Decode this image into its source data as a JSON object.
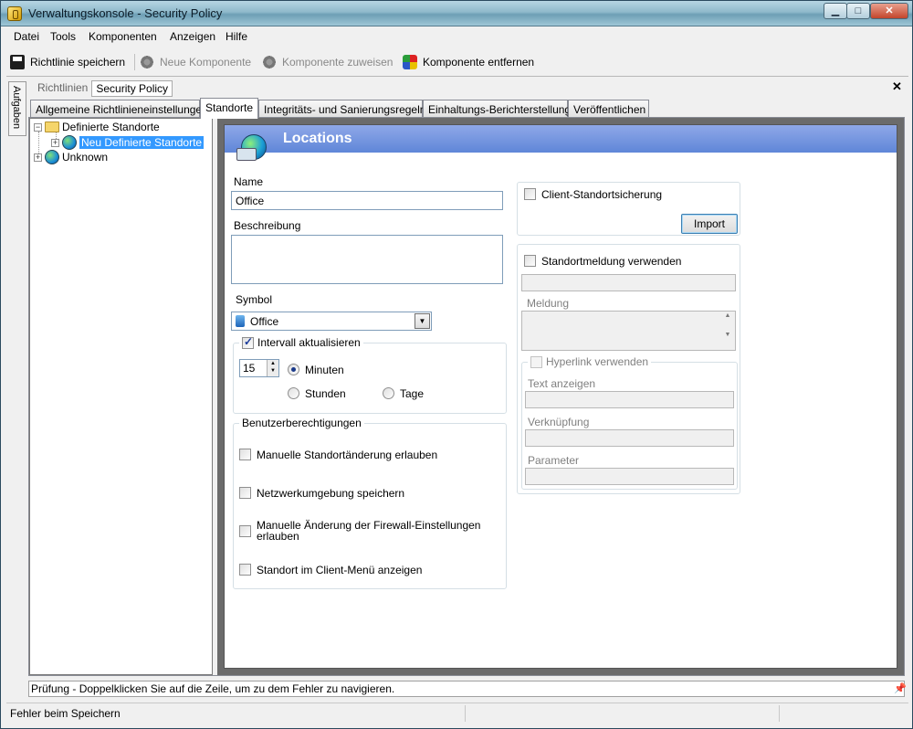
{
  "window": {
    "title": "Verwaltungskonsole - Security Policy",
    "min": "▁",
    "max": "□",
    "close": "✕"
  },
  "menu": {
    "items": [
      "Datei",
      "Tools",
      "Komponenten",
      "Anzeigen",
      "Hilfe"
    ]
  },
  "toolbar": {
    "save": "Richtlinie speichern",
    "new_component": "Neue Komponente",
    "assign_component": "Komponente zuweisen",
    "remove_component": "Komponente entfernen"
  },
  "side_tab": "Aufgaben",
  "breadcrumb": [
    "Richtlinien",
    "Security Policy"
  ],
  "close_pane": "✕",
  "tabs": [
    "Allgemeine Richtlinieneinstellungen",
    "Standorte",
    "Integritäts- und Sanierungsregeln",
    "Einhaltungs-Berichterstellung",
    "Veröffentlichen"
  ],
  "active_tab": "Standorte",
  "tree": {
    "root": "Definierte Standorte",
    "child": "Neu Definierte Standorte",
    "other": "Unknown"
  },
  "panel": {
    "title": "Locations",
    "name_label": "Name",
    "name_value": "Office",
    "description_label": "Beschreibung",
    "description_value": "",
    "symbol_label": "Symbol",
    "symbol_value": "Office",
    "interval": {
      "label": "Intervall aktualisieren",
      "checked": true,
      "value": "15",
      "options": [
        "Minuten",
        "Stunden",
        "Tage"
      ],
      "selected": "Minuten"
    },
    "permissions": {
      "title": "Benutzerberechtigungen",
      "items": [
        "Manuelle Standortänderung erlauben",
        "Netzwerkumgebung speichern",
        "Manuelle Änderung der Firewall-Einstellungen erlauben",
        "Standort im Client-Menü anzeigen"
      ]
    },
    "client_assurance": {
      "label": "Client-Standortsicherung",
      "import_button": "Import"
    },
    "message": {
      "use_label": "Standortmeldung verwenden",
      "message_label": "Meldung",
      "hyperlink_label": "Hyperlink verwenden",
      "display_text_label": "Text anzeigen",
      "link_label": "Verknüpfung",
      "params_label": "Parameter"
    }
  },
  "errors_bar": "Prüfung - Doppelklicken Sie auf die Zeile, um zu dem Fehler zu navigieren.",
  "pin": "📌",
  "status": "Fehler beim Speichern",
  "colors": {
    "header_blue": "#6d90dc",
    "selection": "#3399ff",
    "panel_frame": "#6b6b6b"
  }
}
